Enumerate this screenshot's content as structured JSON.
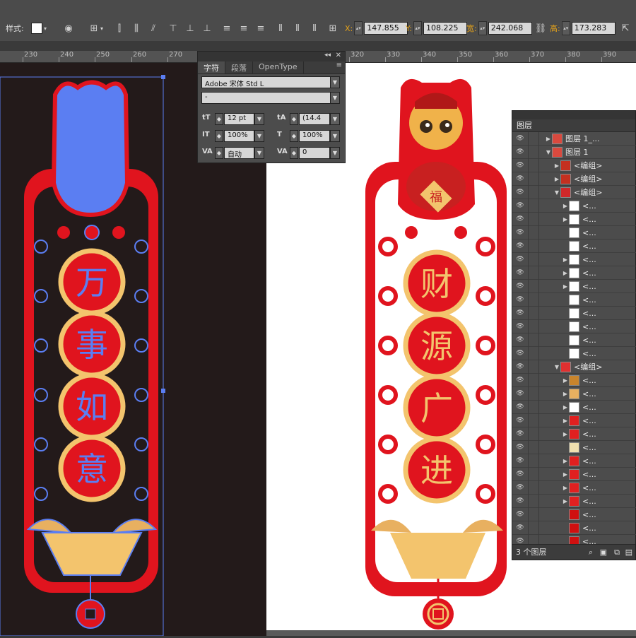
{
  "toolbar": {
    "style_label": "样式:",
    "x_label": "X:",
    "x_value": "147.855",
    "y_label": "Y:",
    "y_value": "108.225",
    "w_label": "宽:",
    "w_value": "242.068",
    "h_label": "高:",
    "h_value": "173.283"
  },
  "ruler": {
    "ticks": [
      "230",
      "240",
      "250",
      "260",
      "270",
      "320",
      "330",
      "340",
      "350",
      "360",
      "370",
      "380",
      "390"
    ]
  },
  "char_panel": {
    "tabs": [
      "字符",
      "段落",
      "OpenType"
    ],
    "font_family": "Adobe 宋体 Std L",
    "font_style": "-",
    "font_size": "12 pt",
    "leading": "(14.4",
    "vscale": "100%",
    "hscale": "100%",
    "kerning": "自动",
    "tracking": "0"
  },
  "layers": {
    "title": "图层",
    "footer": "3 个图层",
    "rows": [
      {
        "name": "图层 1_...",
        "thumb": "#d9493e",
        "tri": "▶"
      },
      {
        "name": "图层 1",
        "thumb": "#d9493e",
        "tri": "▼"
      },
      {
        "name": "<编组>",
        "thumb": "#c43020",
        "tri": "▶"
      },
      {
        "name": "<编组>",
        "thumb": "#c43020",
        "tri": "▶"
      },
      {
        "name": "<编组>",
        "thumb": "#d0282a",
        "tri": "▼"
      },
      {
        "name": "<...",
        "thumb": "#ffffff",
        "tri": "▶"
      },
      {
        "name": "<...",
        "thumb": "#ffffff",
        "tri": "▶"
      },
      {
        "name": "<...",
        "thumb": "#ffffff",
        "tri": ""
      },
      {
        "name": "<...",
        "thumb": "#ffffff",
        "tri": ""
      },
      {
        "name": "<...",
        "thumb": "#ffffff",
        "tri": "▶"
      },
      {
        "name": "<...",
        "thumb": "#ffffff",
        "tri": "▶"
      },
      {
        "name": "<...",
        "thumb": "#ffffff",
        "tri": "▶"
      },
      {
        "name": "<...",
        "thumb": "#ffffff",
        "tri": ""
      },
      {
        "name": "<...",
        "thumb": "#ffffff",
        "tri": ""
      },
      {
        "name": "<...",
        "thumb": "#ffffff",
        "tri": ""
      },
      {
        "name": "<...",
        "thumb": "#ffffff",
        "tri": ""
      },
      {
        "name": "<...",
        "thumb": "#ffffff",
        "tri": ""
      },
      {
        "name": "<编组>",
        "thumb": "#e03030",
        "tri": "▼"
      },
      {
        "name": "<...",
        "thumb": "#c8842c",
        "tri": "▶"
      },
      {
        "name": "<...",
        "thumb": "#e8b060",
        "tri": "▶"
      },
      {
        "name": "<...",
        "thumb": "#ffffff",
        "tri": "▶"
      },
      {
        "name": "<...",
        "thumb": "#e02020",
        "tri": "▶"
      },
      {
        "name": "<...",
        "thumb": "#e02020",
        "tri": "▶"
      },
      {
        "name": "<...",
        "thumb": "#f0e0b0",
        "tri": ""
      },
      {
        "name": "<...",
        "thumb": "#e02020",
        "tri": "▶"
      },
      {
        "name": "<...",
        "thumb": "#e02020",
        "tri": "▶"
      },
      {
        "name": "<...",
        "thumb": "#e02020",
        "tri": "▶"
      },
      {
        "name": "<...",
        "thumb": "#e02020",
        "tri": "▶"
      },
      {
        "name": "<...",
        "thumb": "#d01010",
        "tri": ""
      },
      {
        "name": "<...",
        "thumb": "#d01010",
        "tri": ""
      },
      {
        "name": "<...",
        "thumb": "#d01010",
        "tri": ""
      }
    ]
  },
  "artwork": {
    "left_chars": [
      "万",
      "事",
      "如",
      "意"
    ],
    "right_chars": [
      "财",
      "源",
      "广",
      "进"
    ],
    "badge": "福",
    "red": "#e0141e",
    "gold": "#f3c46d",
    "select_blue": "#5b7ef2"
  }
}
